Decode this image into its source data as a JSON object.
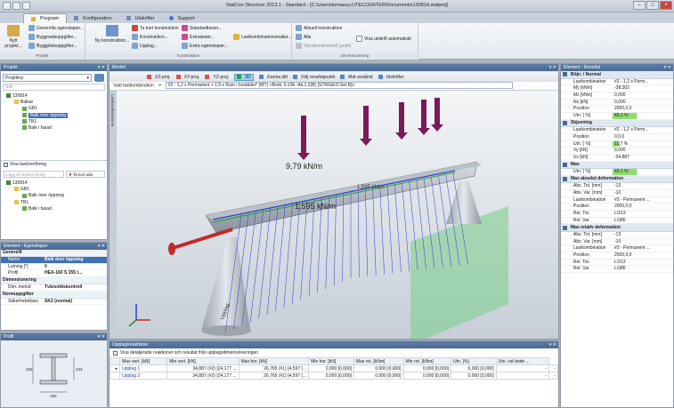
{
  "window": {
    "title": "StatCon Structure 2013.1 - Standard - [C:\\Users\\tomasuu.UTECCENTER\\Documents\\130814.statproj]"
  },
  "tabs": [
    "Program",
    "Konfiguration",
    "Utskrifter",
    "Support"
  ],
  "ribbon": {
    "projekt": {
      "label": "Projekt",
      "new": "Nytt projekt...",
      "items": [
        "Generella egenskaper...",
        "Byggnadsuppgifter...",
        "Byggplatsuppgifter..."
      ]
    },
    "konstruktion": {
      "label": "Konstruktion",
      "new": "Ny konstruktion...",
      "items": [
        "Ta bort konstruktion",
        "Konstruktion...",
        "Upplag...",
        "Standardlaster...",
        "Extralaster...",
        "Extra egenskaper...",
        "Lastkombinationsmallar..."
      ]
    },
    "dimensionering": {
      "label": "Dimensionering",
      "items": [
        "Aktuell konstruktion",
        "Alla",
        "Vibrationskontroll (avbil)"
      ],
      "auto": "Visa utskrift automatiskt"
    }
  },
  "projekt_panel": {
    "title": "Projekt",
    "dropdown": "Projektvy",
    "search_placeholder": "Sök",
    "tree": [
      {
        "label": "130814",
        "level": 0
      },
      {
        "label": "Balkar",
        "level": 1
      },
      {
        "label": "GB1",
        "level": 2
      },
      {
        "label": "Balk över öppning",
        "level": 2,
        "selected": true
      },
      {
        "label": "TB1",
        "level": 2
      },
      {
        "label": "Balk i fasad",
        "level": 2
      }
    ],
    "checkbox": "Visa lastöverföring",
    "btn_add": "Lägg till lastöverföring",
    "btn_remove": "Ta bort alla",
    "tree2": [
      {
        "label": "130814",
        "level": 0
      },
      {
        "label": "GB1",
        "level": 1
      },
      {
        "label": "Balk över öppning",
        "level": 2
      },
      {
        "label": "TB1",
        "level": 1
      },
      {
        "label": "Balk i fasad",
        "level": 2
      }
    ]
  },
  "egenskaper": {
    "title": "Element - Egenskaper",
    "sections": [
      {
        "name": "Generellt",
        "rows": [
          [
            "Namn",
            "Balk över öppning"
          ],
          [
            "Lutning [°]",
            "0"
          ],
          [
            "Profil",
            "HEA-160 S 355 t..."
          ]
        ]
      },
      {
        "name": "Dimensionering",
        "rows": [
          [
            "Dim. metod",
            "Tvärsnittskontroll"
          ]
        ]
      },
      {
        "name": "Normuppgifter",
        "rows": [
          [
            "Säkerhetsklass",
            "SK2 (normal)"
          ]
        ]
      }
    ]
  },
  "profil": {
    "title": "Profil",
    "dim_width": "160",
    "dim_height": "152",
    "dim_web": "134"
  },
  "model": {
    "title": "Modell",
    "toolbar": [
      "XZ-proj.",
      "XY-proj.",
      "YZ-proj.",
      "3D",
      "Zooma allt",
      "Välj resultatpunkt",
      "Mät avstånd",
      "Utskrifter"
    ],
    "combo_label": "Vald lastkombination",
    "combo_value": "#2 - 1,2 x Permanent + 1,5 x Rum i bostäder* (MT)  <Brott.  6.10b -Ak.1.2(B) [STR/GEO:Set B]>",
    "side_label": "Lastkombinationer",
    "loads": [
      "9,79 kN/m",
      "1,595 kN/m",
      "1,595 kN/m"
    ],
    "support_label": "Upplag"
  },
  "results": {
    "title": "Element - Resultat",
    "sections": [
      {
        "name": "Böjn. / Normal",
        "rows": [
          [
            "Lastkombination",
            "#2 - 1,2 x Perm..."
          ],
          [
            "My [kNm]",
            "-38,302"
          ],
          [
            "Mz [kNm]",
            "0,000"
          ],
          [
            "Nx [kN]",
            "0,000"
          ],
          [
            "Position",
            "2000,0,0"
          ],
          [
            "Utn. [ %]",
            "40,1 %"
          ]
        ],
        "util": 0.401
      },
      {
        "name": "Skjuvning",
        "rows": [
          [
            "Lastkombination",
            "#2 - 1,2 x Perm..."
          ],
          [
            "Position",
            "0,0,0"
          ],
          [
            "Utn. [ %]",
            "11,7 %"
          ],
          [
            "Vy [kN]",
            "0,000"
          ],
          [
            "Vz [kN]",
            "-34,887"
          ]
        ],
        "util": 0.117
      },
      {
        "name": "Max",
        "rows": [
          [
            "Utn. [ %]",
            "40,1 %"
          ]
        ],
        "util": 0.401
      },
      {
        "name": "Max absolut deformation",
        "rows": [
          [
            "Abs. Tot. [mm]",
            "-13"
          ],
          [
            "Abs. Var. [mm]",
            "-10"
          ],
          [
            "Lastkombination",
            "#3 - Permanent ..."
          ],
          [
            "Position",
            "2000,0,0"
          ],
          [
            "Rel. Tot.",
            "L/313"
          ],
          [
            "Rel. Var.",
            "L/386"
          ]
        ]
      },
      {
        "name": "Max relativ deformation",
        "rows": [
          [
            "Abs. Tot. [mm]",
            "-13"
          ],
          [
            "Abs. Var. [mm]",
            "-10"
          ],
          [
            "Lastkombination",
            "#3 - Permanent ..."
          ],
          [
            "Position",
            "2000,0,0"
          ],
          [
            "Rel. Tot.",
            "L/313"
          ],
          [
            "Rel. Var.",
            "L/386"
          ]
        ]
      }
    ]
  },
  "reactions": {
    "title": "Upplagsreaktioner",
    "checkbox": "Visa detaljerade reaktioner och resultat från upplagsdimensioneringen",
    "headers": [
      "",
      "Max vert. [kN]",
      "Min vert. [kN]",
      "Max hor. [kN]",
      "Min hor. [kN]",
      "Max rot. [kNm]",
      "Min rot. [kNm]",
      "Utn. [%]",
      "Utn. vid ände ..."
    ],
    "rows": [
      [
        "Upplag 1",
        "34,887 (#2) [24,177 ...",
        "26,765 (#1) [4,597 (...",
        "0,000 [0,000]",
        "0,000 [0,000]",
        "0,000 [0,000]",
        "0,000 [0,000]",
        "-",
        "-"
      ],
      [
        "Upplag 2",
        "34,887 (#2) [24,177 ...",
        "26,765 (#1) [4,597 (...",
        "0,000 [0,000]",
        "0,000 [0,000]",
        "0,000 [0,000]",
        "0,000 [0,000]",
        "-",
        "-"
      ]
    ]
  },
  "colors": {
    "header": "#4d6d95",
    "util_bar": "#90dc70",
    "load_arrow": "#7a1a5a",
    "beam_line": "#2a3bd0",
    "ground": "#7fd190"
  }
}
